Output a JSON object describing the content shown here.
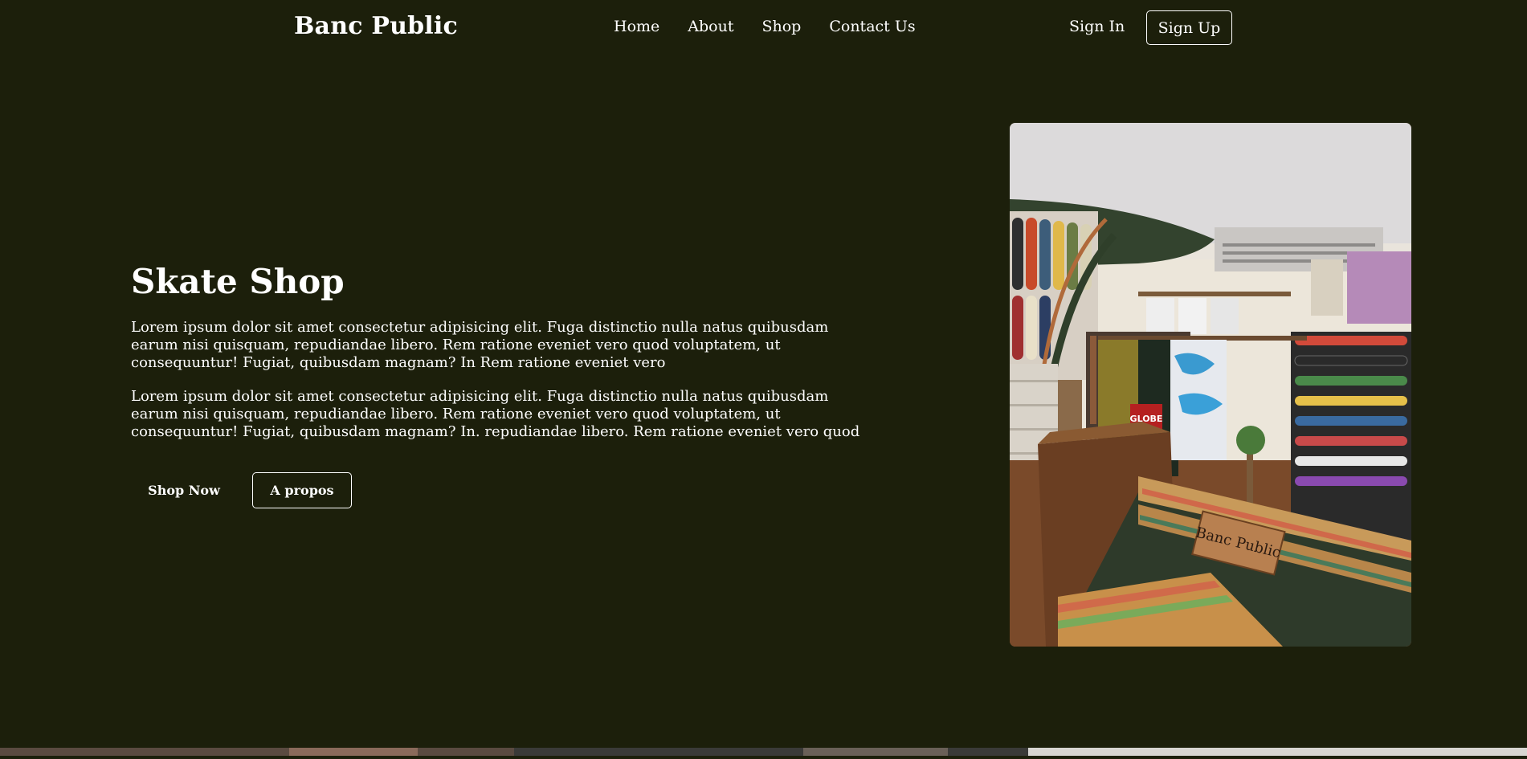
{
  "nav": {
    "logo": "Banc Public",
    "items": [
      "Home",
      "About",
      "Shop",
      "Contact Us"
    ],
    "sign_in": "Sign In",
    "sign_up": "Sign Up"
  },
  "hero": {
    "title": "Skate Shop",
    "paragraph_1": "Lorem ipsum dolor sit amet consectetur adipisicing elit. Fuga distinctio nulla natus quibusdam earum nisi quisquam, repudiandae libero. Rem ratione eveniet vero quod voluptatem, ut consequuntur! Fugiat, quibusdam magnam? In Rem ratione eveniet vero",
    "paragraph_2": "Lorem ipsum dolor sit amet consectetur adipisicing elit. Fuga distinctio nulla natus quibusdam earum nisi quisquam, repudiandae libero. Rem ratione eveniet vero quod voluptatem, ut consequuntur! Fugiat, quibusdam magnam? In. repudiandae libero. Rem ratione eveniet vero quod",
    "primary_button": "Shop Now",
    "secondary_button": "A propos"
  },
  "photo": {
    "bench_sign": "Banc Public",
    "brand_tag": "GLOBE"
  },
  "colors": {
    "background": "#1c1f0b",
    "text": "#ffffff"
  }
}
